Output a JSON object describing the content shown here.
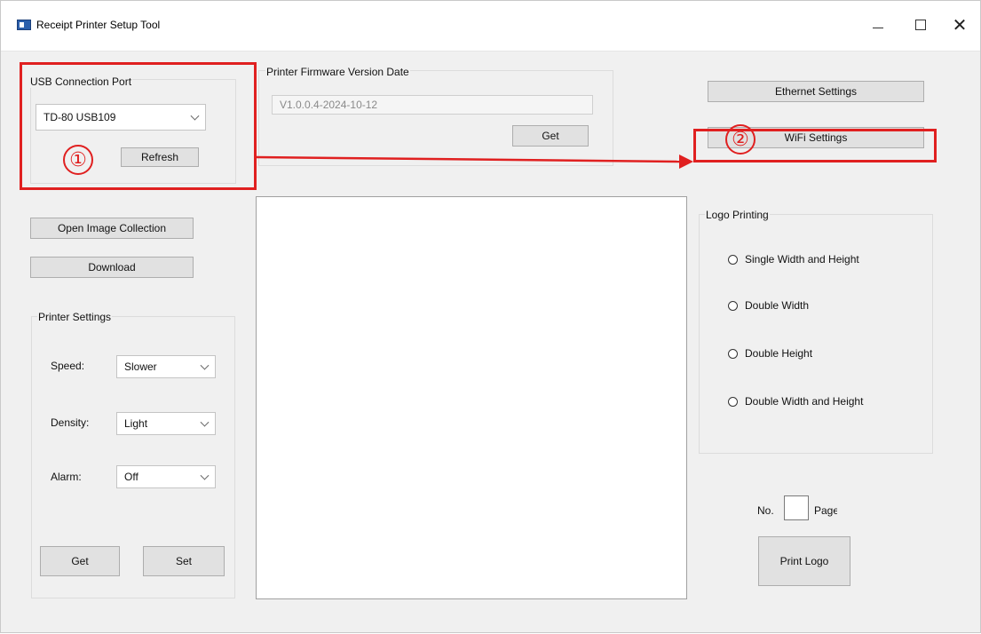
{
  "window": {
    "title": "Receipt Printer Setup Tool",
    "minimize": "minimize",
    "maximize": "maximize",
    "close": "✕"
  },
  "usb": {
    "group_title": "USB Connection Port",
    "port_value": "TD-80 USB109",
    "refresh_label": "Refresh"
  },
  "firmware": {
    "group_title": "Printer Firmware Version Date",
    "version_value": "V1.0.0.4-2024-10-12",
    "get_label": "Get"
  },
  "network": {
    "ethernet_label": "Ethernet Settings",
    "wifi_label": "WiFi Settings"
  },
  "image": {
    "open_collection_label": "Open Image Collection",
    "download_label": "Download"
  },
  "printer_settings": {
    "group_title": "Printer Settings",
    "speed_label": "Speed:",
    "speed_value": "Slower",
    "density_label": "Density:",
    "density_value": "Light",
    "alarm_label": "Alarm:",
    "alarm_value": "Off",
    "get_label": "Get",
    "set_label": "Set"
  },
  "logo_printing": {
    "group_title": "Logo Printing",
    "options": [
      "Single Width and Height",
      "Double Width",
      "Double Height",
      "Double Width and Height"
    ],
    "no_label": "No.",
    "page_label": "Page",
    "print_label": "Print Logo"
  },
  "annotations": {
    "step1": "①",
    "step2": "②",
    "color": "#e02020"
  }
}
